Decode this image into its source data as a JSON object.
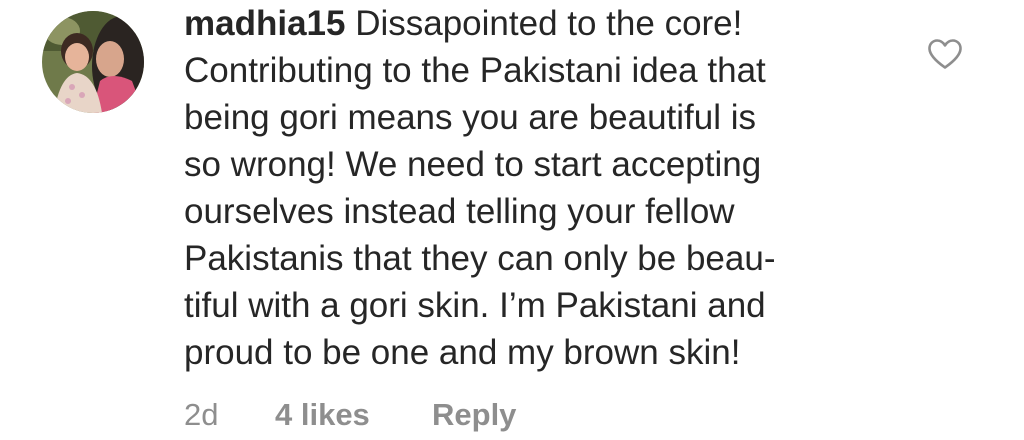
{
  "comment": {
    "username": "madhia15",
    "lines": [
      "Dissapointed to the core!",
      "Contributing to the Pakistani idea that",
      "being gori means you are beautiful is",
      "so wrong! We need to start accepting",
      "ourselves instead telling your fellow",
      "Pakistanis that they can only be beau-",
      "tiful with a gori skin. I’m Pakistani and",
      "proud to be one and my brown skin!"
    ],
    "timestamp": "2d",
    "likes": "4 likes",
    "reply_label": "Reply",
    "icons": {
      "avatar": "profile-photo",
      "like": "heart-outline-icon"
    }
  }
}
